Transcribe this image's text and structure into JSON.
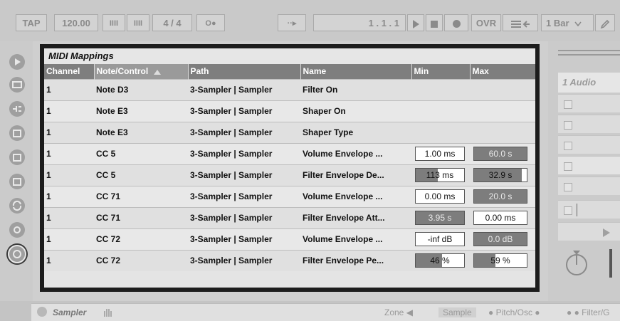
{
  "transport": {
    "tap": "TAP",
    "tempo": "120.00",
    "nudge_down": "IIII",
    "nudge_up": "IIII",
    "time_signature": "4 / 4",
    "metronome": "O●",
    "follow": "··▸",
    "position": "1 .  1 .  1",
    "ovr": "OVR",
    "quantize": "1 Bar"
  },
  "panel": {
    "title": "MIDI Mappings",
    "columns": [
      "Channel",
      "Note/Control",
      "Path",
      "Name",
      "Min",
      "Max"
    ],
    "rows": [
      {
        "channel": "1",
        "note": "Note D3",
        "path": "3-Sampler | Sampler",
        "name": "Filter On",
        "min": "",
        "max": "",
        "min_fill": null,
        "max_fill": null
      },
      {
        "channel": "1",
        "note": "Note E3",
        "path": "3-Sampler | Sampler",
        "name": "Shaper On",
        "min": "",
        "max": "",
        "min_fill": null,
        "max_fill": null
      },
      {
        "channel": "1",
        "note": "Note E3",
        "path": "3-Sampler | Sampler",
        "name": "Shaper Type",
        "min": "",
        "max": "",
        "min_fill": null,
        "max_fill": null
      },
      {
        "channel": "1",
        "note": "CC 5",
        "path": "3-Sampler | Sampler",
        "name": "Volume Envelope ...",
        "min": "1.00 ms",
        "max": "60.0 s",
        "min_fill": 0,
        "max_fill": 1
      },
      {
        "channel": "1",
        "note": "CC 5",
        "path": "3-Sampler | Sampler",
        "name": "Filter Envelope De...",
        "min": "113 ms",
        "max": "32.9 s",
        "min_fill": 0.45,
        "max_fill": 0.9
      },
      {
        "channel": "1",
        "note": "CC 71",
        "path": "3-Sampler | Sampler",
        "name": "Volume Envelope ...",
        "min": "0.00 ms",
        "max": "20.0 s",
        "min_fill": 0,
        "max_fill": 1
      },
      {
        "channel": "1",
        "note": "CC 71",
        "path": "3-Sampler | Sampler",
        "name": "Filter Envelope Att...",
        "min": "3.95 s",
        "max": "0.00 ms",
        "min_fill": 1,
        "max_fill": 0
      },
      {
        "channel": "1",
        "note": "CC 72",
        "path": "3-Sampler | Sampler",
        "name": "Volume Envelope ...",
        "min": "-inf dB",
        "max": "0.0 dB",
        "min_fill": 0,
        "max_fill": 1
      },
      {
        "channel": "1",
        "note": "CC 72",
        "path": "3-Sampler | Sampler",
        "name": "Filter Envelope Pe...",
        "min": "46 %",
        "max": "59 %",
        "min_fill": 0.55,
        "max_fill": 0.4
      }
    ]
  },
  "track": {
    "title": "1 Audio"
  },
  "bottom": {
    "device": "Sampler",
    "tab_zone": "Zone",
    "tab_sample": "Sample",
    "tab_pitch": "Pitch/Osc",
    "tab_filter": "Filter/G"
  }
}
